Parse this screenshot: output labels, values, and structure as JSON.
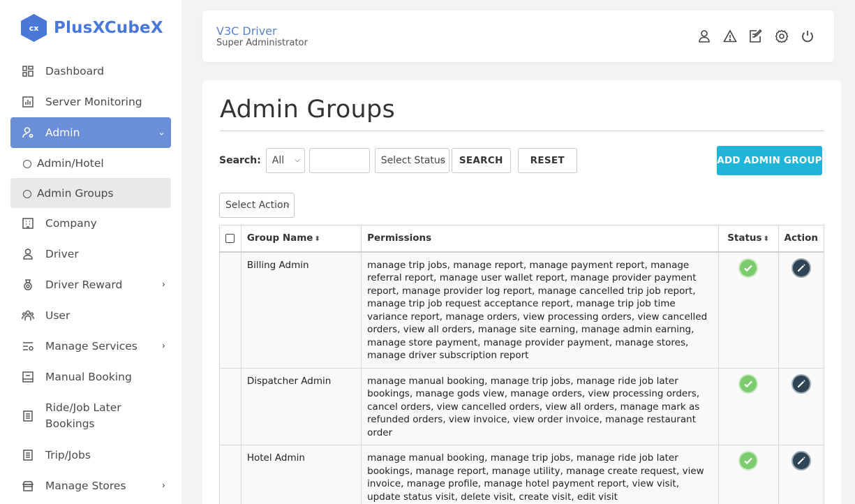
{
  "app": {
    "logo_mark": "cx",
    "logo_text": "PlusXCubeX"
  },
  "sidebar": {
    "items": [
      {
        "label": "Dashboard",
        "icon": "dashboard-icon"
      },
      {
        "label": "Server Monitoring",
        "icon": "chart-icon"
      },
      {
        "label": "Admin",
        "icon": "admin-icon",
        "active": true,
        "expanded": true
      },
      {
        "label": "Admin/Hotel",
        "sub": true
      },
      {
        "label": "Admin Groups",
        "sub": true,
        "selected": true
      },
      {
        "label": "Company",
        "icon": "building-icon"
      },
      {
        "label": "Driver",
        "icon": "driver-icon"
      },
      {
        "label": "Driver Reward",
        "icon": "medal-icon",
        "has_children": true
      },
      {
        "label": "User",
        "icon": "users-icon"
      },
      {
        "label": "Manage Services",
        "icon": "services-icon",
        "has_children": true
      },
      {
        "label": "Manual Booking",
        "icon": "booking-icon"
      },
      {
        "label": "Ride/Job Later Bookings",
        "icon": "list-icon"
      },
      {
        "label": "Trip/Jobs",
        "icon": "list-icon"
      },
      {
        "label": "Manage Stores",
        "icon": "store-icon",
        "has_children": true
      }
    ]
  },
  "header": {
    "user_name": "V3C Driver",
    "user_role": "Super Administrator",
    "icons": [
      "user-icon",
      "alert-icon",
      "edit-note-icon",
      "settings-icon",
      "power-icon"
    ]
  },
  "main": {
    "title": "Admin Groups",
    "search": {
      "label": "Search:",
      "scope_value": "All",
      "text_value": "",
      "status_value": "Select Status",
      "search_button": "SEARCH",
      "reset_button": "RESET"
    },
    "add_button": "ADD ADMIN GROUP",
    "bulk_action_value": "Select Action"
  },
  "table": {
    "columns": [
      "Group Name",
      "Permissions",
      "Status",
      "Action"
    ],
    "rows": [
      {
        "group_name": "Billing Admin",
        "permissions": "manage trip jobs, manage report, manage payment report, manage referral report, manage user wallet report, manage provider payment report, manage provider log report, manage cancelled trip job report, manage trip job request acceptance report, manage trip job time variance report, manage orders, view processing orders, view cancelled orders, view all orders, manage site earning, manage admin earning, manage store payment, manage provider payment, manage stores, manage driver subscription report",
        "status": "active"
      },
      {
        "group_name": "Dispatcher Admin",
        "permissions": "manage manual booking, manage trip jobs, manage ride job later bookings, manage gods view, manage orders, view processing orders, cancel orders, view cancelled orders, view all orders, manage mark as refunded orders, view invoice, view order invoice, manage restaurant order",
        "status": "active"
      },
      {
        "group_name": "Hotel Admin",
        "permissions": "manage manual booking, manage trip jobs, manage ride job later bookings, manage report, manage utility, manage create request, view invoice, manage profile, manage hotel payment report, view visit, update status visit, delete visit, create visit, edit visit",
        "status": "active"
      }
    ]
  },
  "colors": {
    "accent": "#4a78d8",
    "active_nav": "#6b8fd6",
    "add_button": "#1fb5d8",
    "status_ok": "#7ccb6e",
    "edit": "#2f4454"
  }
}
